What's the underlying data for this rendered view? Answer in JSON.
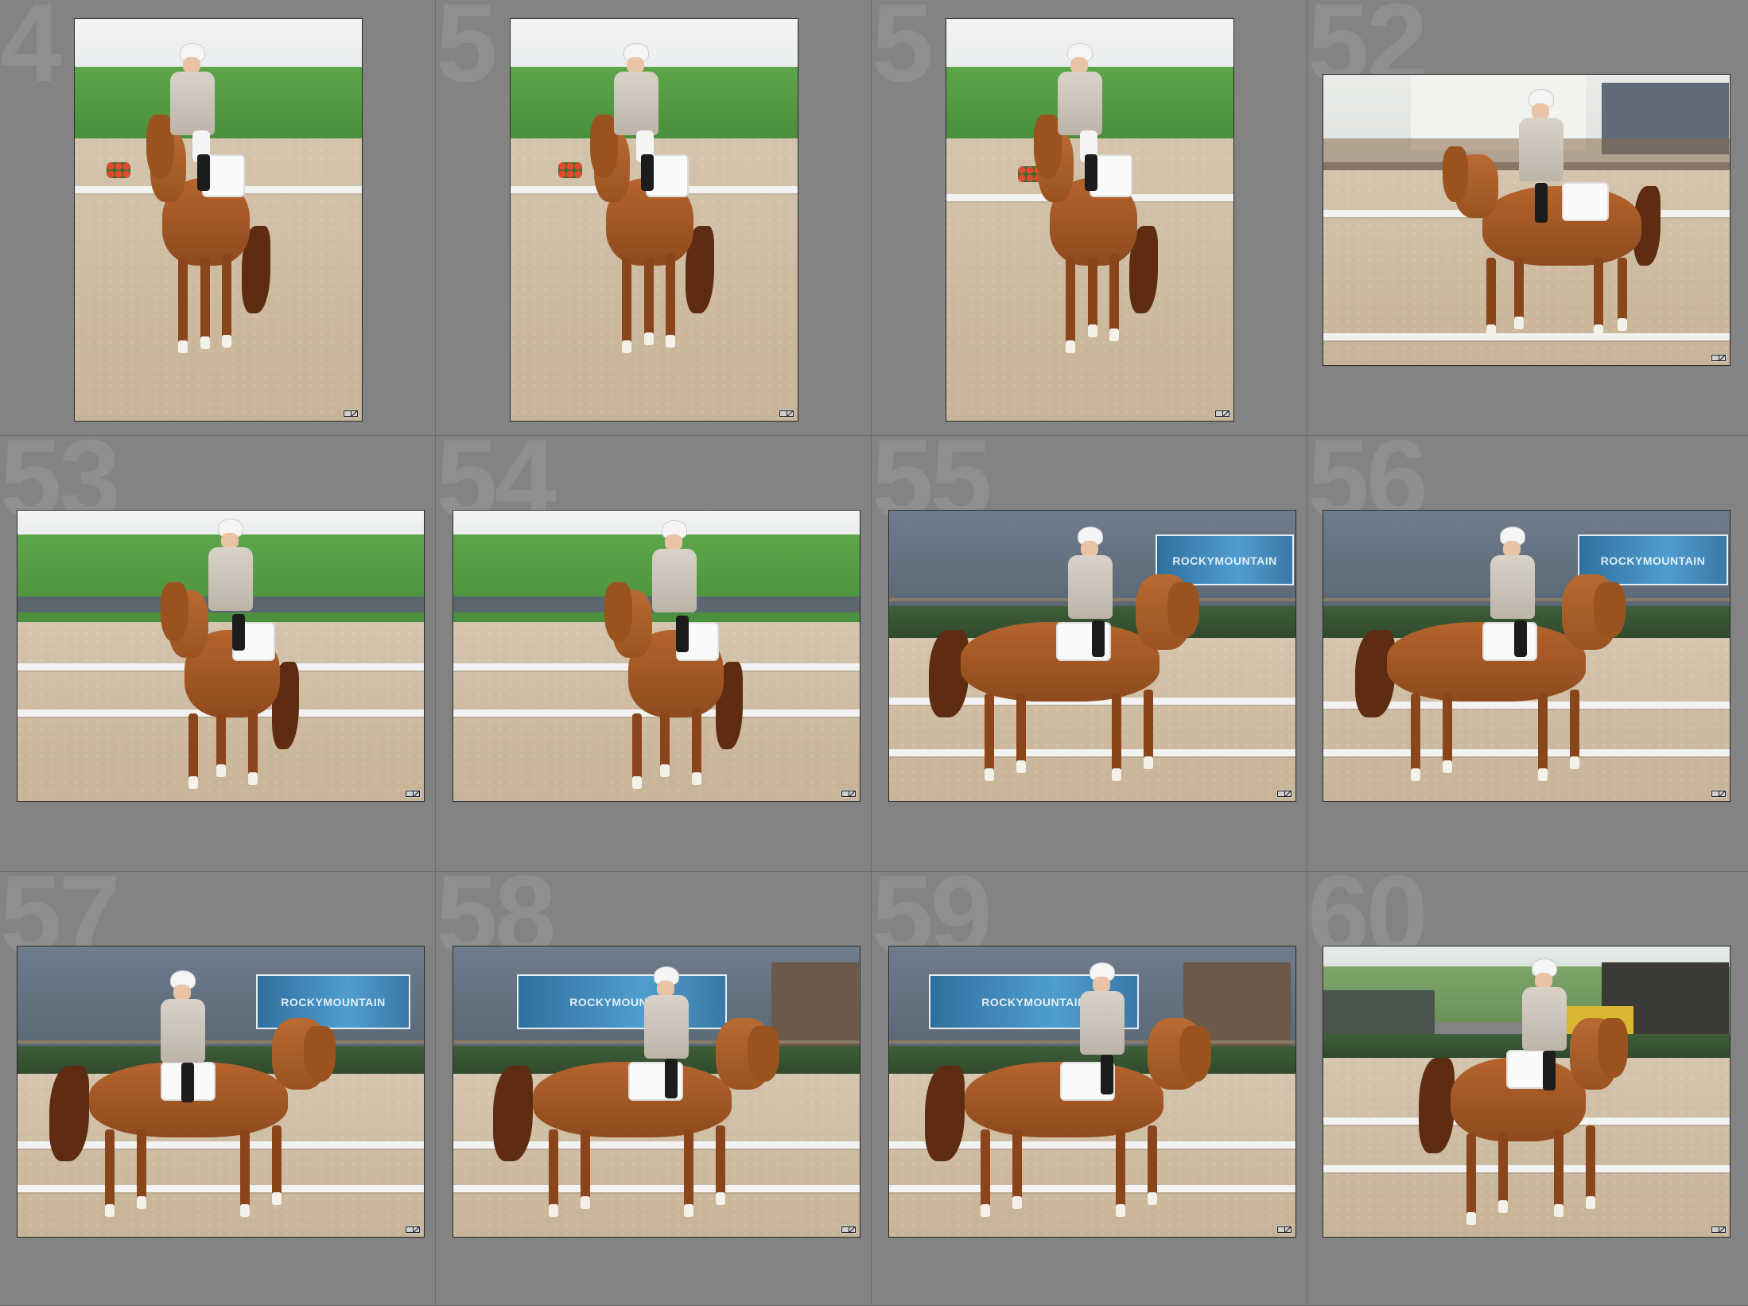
{
  "grid": {
    "cells": [
      {
        "index": "4",
        "orientation": "portrait",
        "scene": "hill-front"
      },
      {
        "index": "5",
        "orientation": "portrait",
        "scene": "hill-front"
      },
      {
        "index": "5",
        "orientation": "portrait",
        "scene": "hill-front"
      },
      {
        "index": "52",
        "orientation": "landscape",
        "scene": "tent-diagonal"
      },
      {
        "index": "53",
        "orientation": "landscape",
        "scene": "hill-front"
      },
      {
        "index": "54",
        "orientation": "landscape",
        "scene": "hill-front"
      },
      {
        "index": "55",
        "orientation": "landscape",
        "scene": "building-side"
      },
      {
        "index": "56",
        "orientation": "landscape",
        "scene": "building-side"
      },
      {
        "index": "57",
        "orientation": "landscape",
        "scene": "building-side"
      },
      {
        "index": "58",
        "orientation": "landscape",
        "scene": "building-side"
      },
      {
        "index": "59",
        "orientation": "landscape",
        "scene": "building-side"
      },
      {
        "index": "60",
        "orientation": "landscape",
        "scene": "field-diagonal"
      }
    ]
  },
  "banner_text": "ROCKYMOUNTAIN",
  "icons": {
    "cell_badge": "edit-crop-badge-icon"
  },
  "colors": {
    "background": "#808080",
    "cell": "#838383",
    "index_number": "#8f8f8f"
  }
}
